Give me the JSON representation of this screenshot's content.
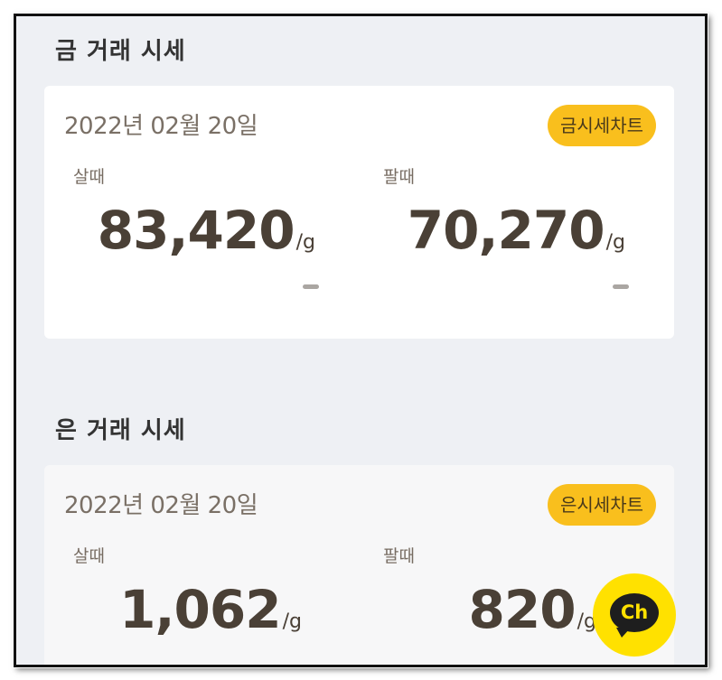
{
  "gold": {
    "section_title": "금 거래 시세",
    "date": "2022년 02월 20일",
    "chart_button": "금시세차트",
    "buy": {
      "label": "살때",
      "price": "83,420",
      "unit": "/g"
    },
    "sell": {
      "label": "팔때",
      "price": "70,270",
      "unit": "/g"
    }
  },
  "silver": {
    "section_title": "은 거래 시세",
    "date": "2022년 02월 20일",
    "chart_button": "은시세차트",
    "buy": {
      "label": "살때",
      "price": "1,062",
      "unit": "/g"
    },
    "sell": {
      "label": "팔때",
      "price": "820",
      "unit": "/g"
    }
  },
  "channel_button": {
    "label": "Ch",
    "icon": "kakao-channel-icon",
    "color": "#ffe100"
  },
  "colors": {
    "accent": "#f9bf1d",
    "background": "#eef0f4",
    "price_text": "#4a4036"
  }
}
